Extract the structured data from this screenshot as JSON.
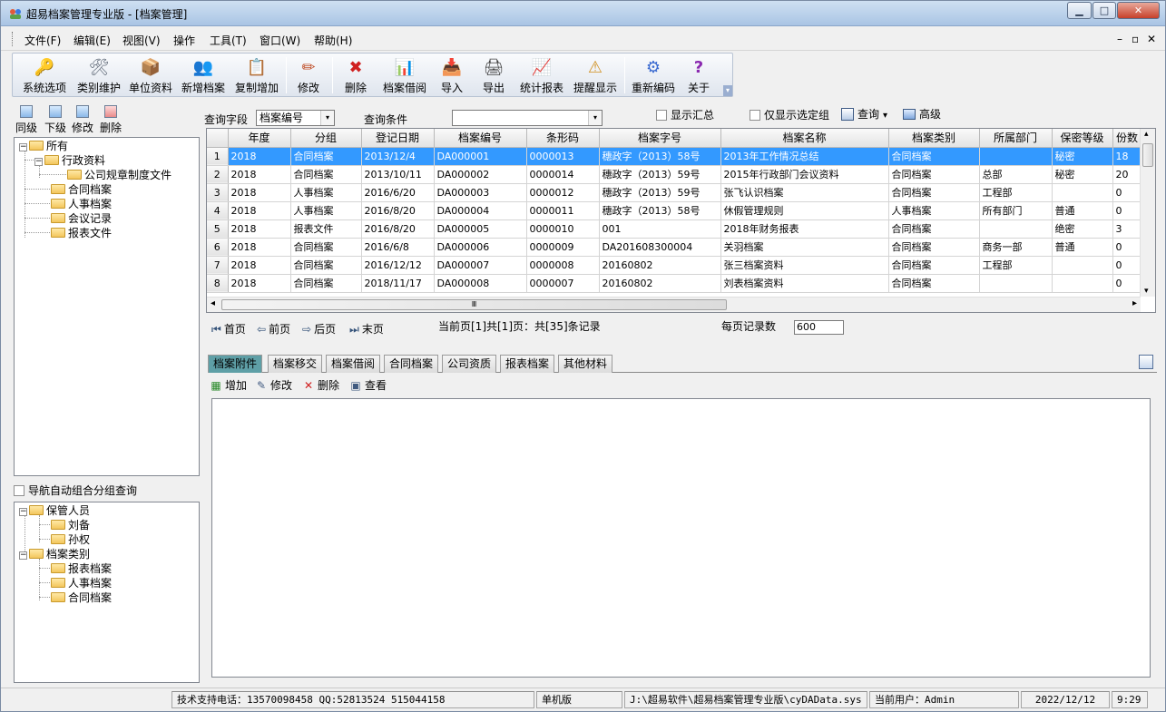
{
  "window": {
    "title": "超易档案管理专业版 - [档案管理]",
    "btn_min": "▁",
    "btn_max": "□",
    "btn_close": "✕"
  },
  "menu": {
    "items": [
      "文件(F)",
      "编辑(E)",
      "视图(V)",
      "操作",
      "工具(T)",
      "窗口(W)",
      "帮助(H)"
    ],
    "mdi_min": "–",
    "mdi_restore": "▫",
    "mdi_close": "✕"
  },
  "toolbar": {
    "buttons": [
      {
        "label": "系统选项",
        "icon": "key-icon",
        "glyph": "🔑"
      },
      {
        "label": "类别维护",
        "icon": "tools-icon",
        "glyph": "🛠"
      },
      {
        "label": "单位资料",
        "icon": "folder-db-icon",
        "glyph": "📦"
      },
      {
        "label": "新增档案",
        "icon": "add-user-icon",
        "glyph": "👥"
      },
      {
        "label": "复制增加",
        "icon": "copy-add-icon",
        "glyph": "📋"
      },
      {
        "label": "修改",
        "icon": "pencil-icon",
        "glyph": "✏"
      },
      {
        "label": "删除",
        "icon": "delete-x-icon",
        "glyph": "✖"
      },
      {
        "label": "档案借阅",
        "icon": "bar-chart-icon",
        "glyph": "📊"
      },
      {
        "label": "导入",
        "icon": "import-icon",
        "glyph": "📥"
      },
      {
        "label": "导出",
        "icon": "printer-icon",
        "glyph": "🖨"
      },
      {
        "label": "统计报表",
        "icon": "report-chart-icon",
        "glyph": "📈"
      },
      {
        "label": "提醒显示",
        "icon": "reminder-icon",
        "glyph": "⚠"
      },
      {
        "label": "重新编码",
        "icon": "recode-icon",
        "glyph": "⚙"
      },
      {
        "label": "关于",
        "icon": "question-icon",
        "glyph": "?"
      }
    ]
  },
  "left": {
    "tools": [
      "同级",
      "下级",
      "修改",
      "删除"
    ],
    "tree1": [
      {
        "label": "所有"
      },
      {
        "label": "行政资料"
      },
      {
        "label": "公司规章制度文件"
      },
      {
        "label": "合同档案"
      },
      {
        "label": "人事档案"
      },
      {
        "label": "会议记录"
      },
      {
        "label": "报表文件"
      }
    ],
    "nav_checkbox": "导航自动组合分组查询",
    "tree2": [
      {
        "label": "保管人员"
      },
      {
        "label": "刘备"
      },
      {
        "label": "孙权"
      },
      {
        "label": "档案类别"
      },
      {
        "label": "报表档案"
      },
      {
        "label": "人事档案"
      },
      {
        "label": "合同档案"
      }
    ],
    "exp_minus": "−"
  },
  "query": {
    "field_label": "查询字段",
    "field_value": "档案编号",
    "cond_label": "查询条件",
    "cond_value": "",
    "show_summary": "显示汇总",
    "only_selected": "仅显示选定组",
    "search": "查询",
    "advanced": "高级"
  },
  "grid": {
    "columns": [
      "",
      "年度",
      "分组",
      "登记日期",
      "档案编号",
      "条形码",
      "档案字号",
      "档案名称",
      "档案类别",
      "所属部门",
      "保密等级",
      "份数"
    ],
    "rows": [
      [
        "1",
        "2018",
        "合同档案",
        "2013/12/4",
        "DA000001",
        "0000013",
        "穗政字（2013）58号",
        "2013年工作情况总结",
        "合同档案",
        "",
        "秘密",
        "18"
      ],
      [
        "2",
        "2018",
        "合同档案",
        "2013/10/11",
        "DA000002",
        "0000014",
        "穗政字（2013）59号",
        "2015年行政部门会议资料",
        "合同档案",
        "总部",
        "秘密",
        "20"
      ],
      [
        "3",
        "2018",
        "人事档案",
        "2016/6/20",
        "DA000003",
        "0000012",
        "穗政字（2013）59号",
        "张飞认识档案",
        "合同档案",
        "工程部",
        "",
        "0"
      ],
      [
        "4",
        "2018",
        "人事档案",
        "2016/8/20",
        "DA000004",
        "0000011",
        "穗政字（2013）58号",
        "休假管理规则",
        "人事档案",
        "所有部门",
        "普通",
        "0"
      ],
      [
        "5",
        "2018",
        "报表文件",
        "2016/8/20",
        "DA000005",
        "0000010",
        "001",
        "2018年财务报表",
        "合同档案",
        "",
        "绝密",
        "3"
      ],
      [
        "6",
        "2018",
        "合同档案",
        "2016/6/8",
        "DA000006",
        "0000009",
        "DA201608300004",
        "关羽档案",
        "合同档案",
        "商务一部",
        "普通",
        "0"
      ],
      [
        "7",
        "2018",
        "合同档案",
        "2016/12/12",
        "DA000007",
        "0000008",
        "20160802",
        "张三档案资料",
        "合同档案",
        "工程部",
        "",
        "0"
      ],
      [
        "8",
        "2018",
        "合同档案",
        "2018/11/17",
        "DA000008",
        "0000007",
        "20160802",
        "刘表档案资料",
        "合同档案",
        "",
        "",
        "0"
      ]
    ],
    "hscroll_mark": "Ⅲ",
    "arrow_left": "◂",
    "arrow_right": "▸",
    "arrow_up": "▴",
    "arrow_down": "▾"
  },
  "pager": {
    "first": "首页",
    "prev": "前页",
    "next": "后页",
    "last": "末页",
    "info": "当前页[1]共[1]页：共[35]条记录",
    "page_size_label": "每页记录数",
    "page_size": "600"
  },
  "tabs": [
    "档案附件",
    "档案移交",
    "档案借阅",
    "合同档案",
    "公司资质",
    "报表档案",
    "其他材料"
  ],
  "attach": {
    "add": "增加",
    "edit": "修改",
    "delete": "删除",
    "view": "查看"
  },
  "status": {
    "support": "技术支持电话：13570098458 QQ:52813524 515044158",
    "mode": "单机版",
    "path": "J:\\超易软件\\超易档案管理专业版\\cyDAData.sys",
    "user": "当前用户：Admin",
    "date": "2022/12/12",
    "time": "9:29"
  },
  "colors": {
    "selected_row": "#3399ff",
    "active_tab": "#5e9fa6"
  }
}
